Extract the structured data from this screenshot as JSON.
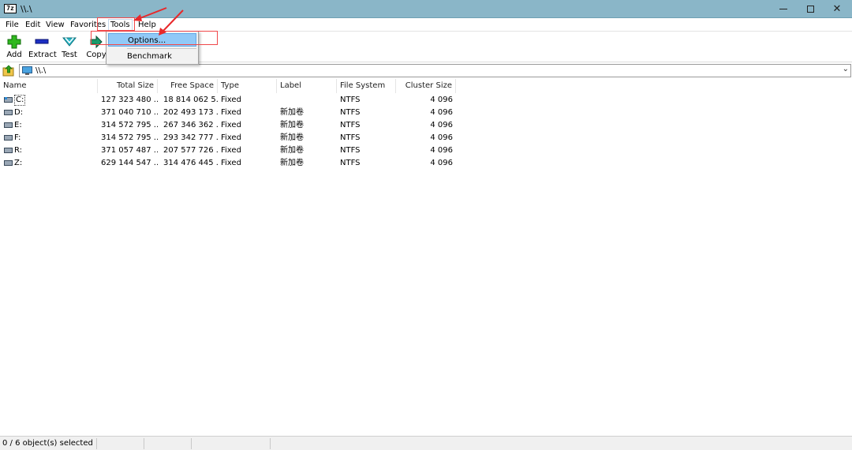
{
  "window": {
    "title": "\\\\.\\",
    "app_icon_text": "7z"
  },
  "menu": [
    "File",
    "Edit",
    "View",
    "Favorites",
    "Tools",
    "Help"
  ],
  "toolbar": {
    "add": "Add",
    "extract": "Extract",
    "test": "Test",
    "copy": "Copy"
  },
  "address": {
    "path": "\\\\.\\"
  },
  "columns": [
    "Name",
    "Total Size",
    "Free Space",
    "Type",
    "Label",
    "File System",
    "Cluster Size"
  ],
  "rows": [
    {
      "name": "C:",
      "total": "127 323 480 ...",
      "free": "18 814 062 5...",
      "type": "Fixed",
      "label": "",
      "fs": "NTFS",
      "cluster": "4 096"
    },
    {
      "name": "D:",
      "total": "371 040 710 ...",
      "free": "202 493 173 ...",
      "type": "Fixed",
      "label": "新加卷",
      "fs": "NTFS",
      "cluster": "4 096"
    },
    {
      "name": "E:",
      "total": "314 572 795 ...",
      "free": "267 346 362 ...",
      "type": "Fixed",
      "label": "新加卷",
      "fs": "NTFS",
      "cluster": "4 096"
    },
    {
      "name": "F:",
      "total": "314 572 795 ...",
      "free": "293 342 777 ...",
      "type": "Fixed",
      "label": "新加卷",
      "fs": "NTFS",
      "cluster": "4 096"
    },
    {
      "name": "R:",
      "total": "371 057 487 ...",
      "free": "207 577 726 ...",
      "type": "Fixed",
      "label": "新加卷",
      "fs": "NTFS",
      "cluster": "4 096"
    },
    {
      "name": "Z:",
      "total": "629 144 547 ...",
      "free": "314 476 445 ...",
      "type": "Fixed",
      "label": "新加卷",
      "fs": "NTFS",
      "cluster": "4 096"
    }
  ],
  "tools_menu": {
    "options": "Options...",
    "benchmark": "Benchmark"
  },
  "status": {
    "text": "0 / 6 object(s) selected"
  },
  "colors": {
    "titlebar": "#8ab6c8",
    "highlight": "#91c9f7",
    "annotation": "#f0484a",
    "add_green": "#2fb81e",
    "extract_blue": "#1c2fc4",
    "test_cyan": "#2ab8c8"
  },
  "icons": {
    "add": "plus-icon",
    "extract": "minus-icon",
    "test": "check-icon",
    "copy": "arrow-right-icon",
    "up": "folder-up-icon",
    "computer": "computer-icon",
    "drive": "drive-icon"
  }
}
